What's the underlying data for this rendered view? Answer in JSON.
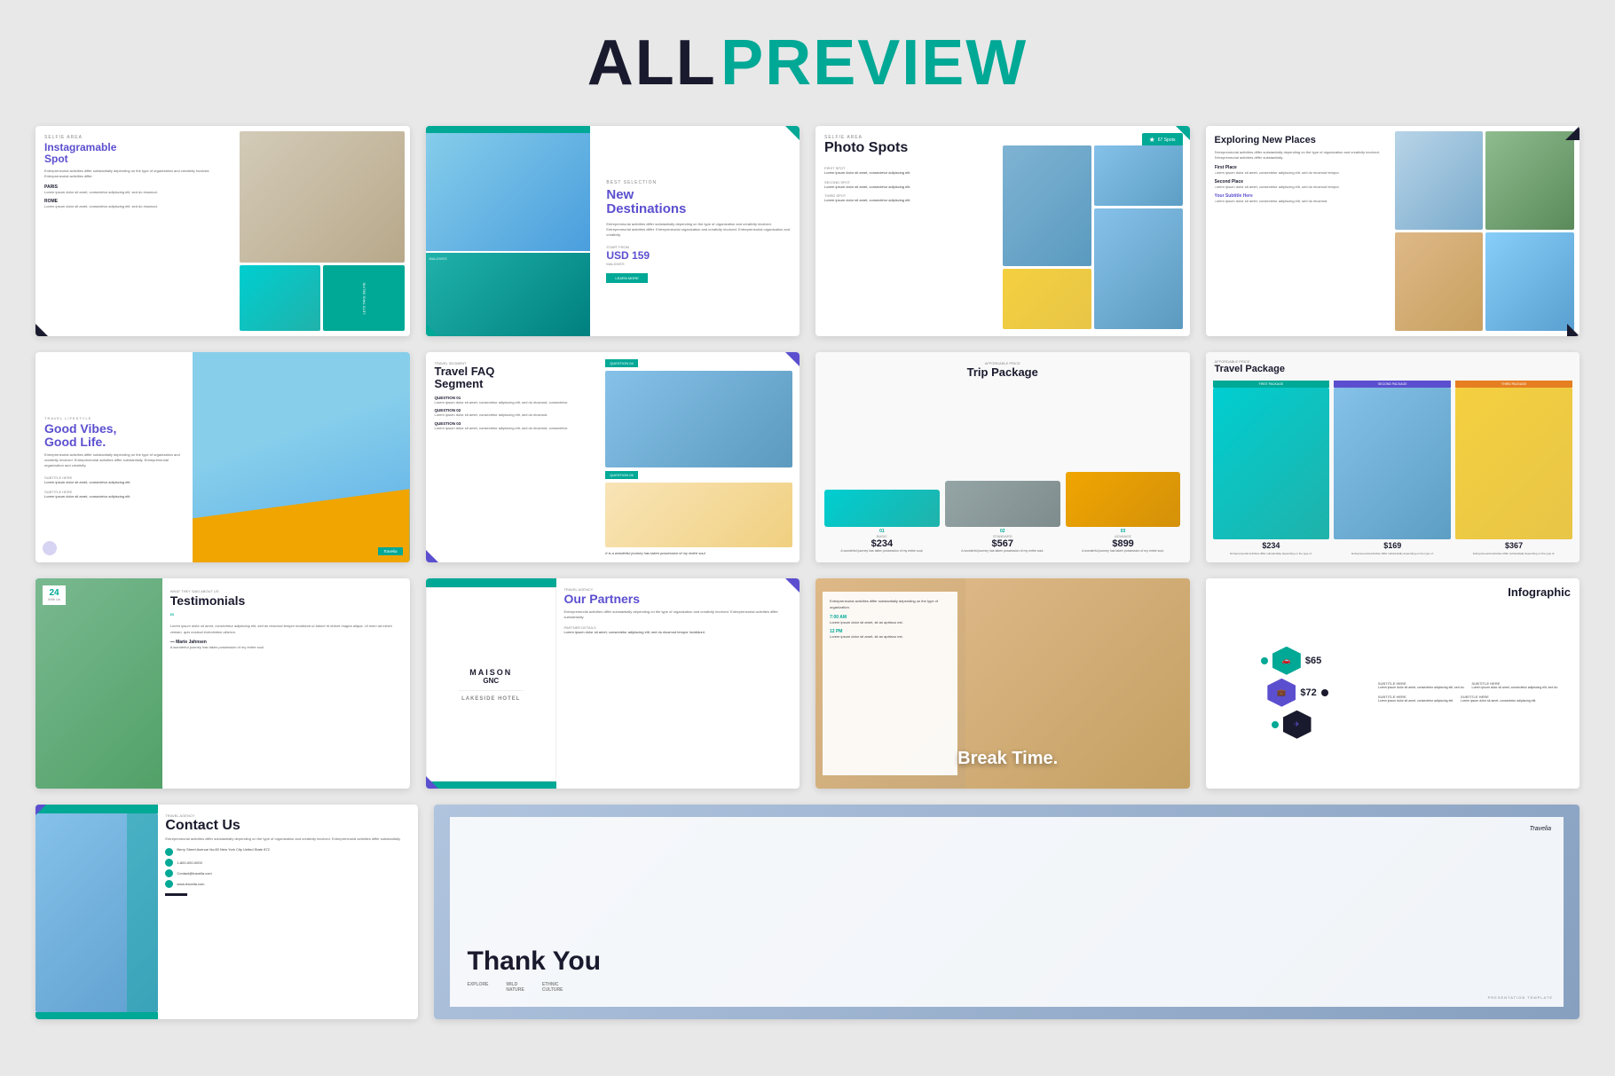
{
  "header": {
    "all": "ALL",
    "preview": "PREVIEW"
  },
  "slides": {
    "slide1": {
      "tag": "SELFIE AREA",
      "title": "Instagramable\nSpot",
      "desc": "Entrepreneurial activities differ substantially depending on the type of organization and creativity involved. Entrepreneurial activities differ.",
      "paris_label": "PARIS",
      "paris_desc": "Lorem ipsum dolor sit amet, consectetur adipiscing elit, sed do eiusmod.",
      "rome_label": "ROME",
      "rome_desc": "Lorem ipsum dolor sit amet, consectetur adipiscing elit, sed do eiusmod."
    },
    "slide2": {
      "tag": "BEST SELECTION",
      "title": "New\nDestinations",
      "desc": "Entrepreneurial activities differ substantially depending on the type of organization and creativity involved. Entrepreneurial activities differ. Entrepreneurial organization and creativity involved. Entrepreneurial organization and creativity.",
      "start_from": "START FROM",
      "price": "USD 159",
      "location": "MALDIVES",
      "btn": "LEARN MORE"
    },
    "slide3": {
      "tag": "SELFIE AREA",
      "title": "Photo Spots",
      "spots_badge": "67 Spots",
      "first_spot": "FIRST SPOT",
      "first_desc": "Lorem ipsum dolor sit amet, consectetur adipiscing elit.",
      "second_spot": "SECOND SPOT",
      "second_desc": "Lorem ipsum dolor sit amet, consectetur adipiscing elit.",
      "third_spot": "THIRD SPOT",
      "third_desc": "Lorem ipsum dolor sit amet, consectetur adipiscing elit."
    },
    "slide4": {
      "title": "Exploring New Places",
      "desc": "Entrepreneurial activities differ substantially depending on the type of organization and creativity involved. Entrepreneurial activities differ substantially.",
      "first_place": "First Place",
      "first_desc": "Lorem ipsum dolor sit amet, consectetur adipiscing elit, sed do eiusmod tempor.",
      "second_place": "Second Place",
      "second_desc": "Lorem ipsum dolor sit amet, consectetur adipiscing elit, sed do eiusmod tempor.",
      "subtitle": "Your Subtitle Here",
      "subtitle_desc": "Lorem ipsum dolor sit amet, consectetur adipiscing elit, sed do eiusmod."
    },
    "slide5": {
      "tag": "TRAVEL LIFESTYLE",
      "title": "Good Vibes,\nGood Life.",
      "desc": "Entrepreneurial activities differ substantially depending on the type of organization and creativity involved. Entrepreneurial activities differ substantially. Entrepreneurial organization and creativity.",
      "subtitle1": "SUBTITLE HERE",
      "sub1_val": "Lorem ipsum dolor sit amet, consectetur adipiscing elit.",
      "subtitle2": "SUBTITLE HERE",
      "sub2_val": "Lorem ipsum dolor sit amet, consectetur adipiscing elit.",
      "brand": "Travelia"
    },
    "slide6": {
      "tag": "TRAVEL SEGMENT",
      "title": "Travel FAQ\nSegment",
      "q1": "QUESTION 01",
      "a1": "Lorem ipsum dolor sit amet, consectetur adipiscing elit, sed do eiusmod, consectetur.",
      "q2": "QUESTION 02",
      "a2": "Lorem ipsum dolor sit amet, consectetur adipiscing elit, sed do eiusmod.",
      "q3": "QUESTION 03",
      "a3": "Lorem ipsum dolor sit amet, consectetur adipiscing elit, sed do eiusmod, consectetur.",
      "badge1": "QUESTION 04",
      "badge2": "QUESTION 05",
      "answer": "It is a wonderful journey has taken possession of my entire soul."
    },
    "slide7": {
      "tag": "AFFORDABLE PRICE",
      "title": "Trip Package",
      "pkg1_num": "01",
      "pkg1_type": "BASIC",
      "pkg1_price": "$234",
      "pkg1_desc": "A wonderful journey has taken possession of my entire soul.",
      "pkg2_num": "02",
      "pkg2_type": "STANDARD",
      "pkg2_price": "$567",
      "pkg2_desc": "A wonderful journey has taken possession of my entire soul.",
      "pkg3_num": "03",
      "pkg3_type": "ADVANCE",
      "pkg3_price": "$899",
      "pkg3_desc": "A wonderful journey has taken possession of my entire soul."
    },
    "slide8": {
      "tag": "AFFORDABLE PRICE",
      "title": "Travel Package",
      "pkg1_header": "FIRST PACKAGE",
      "pkg1_price": "$234",
      "pkg2_header": "SECOND PACKAGE",
      "pkg2_price": "$169",
      "pkg3_header": "THIRD PACKAGE",
      "pkg3_price": "$367",
      "desc": "Entrepreneurial activities differ substantially depending on the type of."
    },
    "slide9": {
      "days": "24",
      "days_label": "With Us",
      "tag": "WHAT THEY SAID ABOUT US",
      "title": "Testimonials",
      "quote": "Lorem ipsum dolor sit amet, consectetur adipiscing elit, sed do eiusmod tempor incididunt ut labore et dolore magna aliqua. Ut enim ad minim veniam, quis nostrud exercitation ullamco.",
      "author": "— Marie Jahnsen",
      "author_sub": "A wonderful journey has taken possession of my entire soul."
    },
    "slide10": {
      "tag": "TRAVEL AGENCY",
      "title": "Our Partners",
      "partner1": "MAISON",
      "partner1_sub": "GNC",
      "partner2": "LAKESIDE HOTEL",
      "desc": "Entrepreneurial activities differ substantially depending on the type of organization and creativity involved. Entrepreneurial activities differ substantially.",
      "partner_details": "PARTNER DETAILS",
      "partner_val": "Lorem ipsum dolor sit amet, consectetur adipiscing elit, sed do eiusmod tempor incididunt."
    },
    "slide11": {
      "desc": "Entrepreneurial activities differ substantially depending on the type of organization.",
      "time1": "7:00 AM",
      "time1_desc": "Lorem ipsum dolor sit amet, sit an aptriscu est.",
      "time2": "12 PM",
      "time2_desc": "Lorem ipsum dolor sit amet, sit an aptriscu est.",
      "break_title": "Break Time."
    },
    "slide12": {
      "title": "Infographic",
      "price1": "$65",
      "price2": "$72",
      "subtitle1": "SUBTITLE HERE",
      "sub1_val": "Lorem ipsum dolor sit amet, consectetur adipiscing elit, sed do.",
      "subtitle2": "SUBTITLE HERE",
      "sub2_val": "Lorem ipsum dolor sit amet, consectetur adipiscing elit, sed do.",
      "subtitle3": "SUBTITLE HERE",
      "sub3_val": "Lorem ipsum dolor sit amet, consectetur adipiscing elit.",
      "subtitle4": "SUBTITLE HERE",
      "sub4_val": "Lorem ipsum dolor sit amet, consectetur adipiscing elit."
    },
    "slide13": {
      "tag": "TRAVEL AGENCY",
      "title": "Contact Us",
      "desc": "Entrepreneurial activities differ substantially depending on the type of organization and creativity involved. Entrepreneurial activities differ substantially.",
      "address_label": "Berry Street Avenue No.80 New York City United State 872",
      "phone_label": "1-800-000-0000",
      "email_label": "Contact@travella.com",
      "web_label": "www.travella.com"
    },
    "slide14": {
      "brand": "Travelia",
      "thank_you": "Thank You",
      "kw1_label": "EXPLORE",
      "kw2_label": "WILD\nNATURE",
      "kw3_label": "ETHNIC\nCULTURE",
      "presentation_tag": "PRESENTATION TEMPLATE"
    }
  },
  "colors": {
    "teal": "#00a896",
    "purple": "#5b4fcf",
    "dark": "#1a1a2e",
    "gray": "#888888",
    "light_gray": "#eeeeee"
  }
}
